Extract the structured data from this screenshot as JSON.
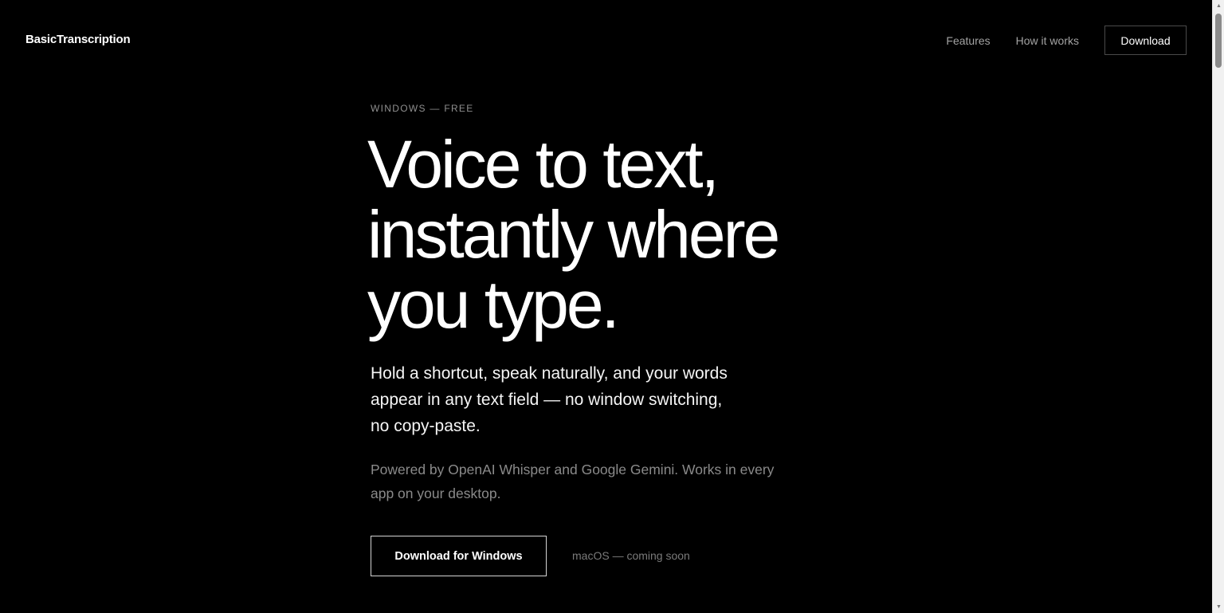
{
  "header": {
    "logo": "BasicTranscription",
    "nav": {
      "features": "Features",
      "how_it_works": "How it works",
      "download": "Download"
    }
  },
  "hero": {
    "eyebrow": "WINDOWS — FREE",
    "headline_lines": [
      "Voice to text,",
      "instantly where",
      "you type."
    ],
    "subhead": "Hold a shortcut, speak naturally, and your words appear in any text field — no window switching, no copy-paste.",
    "note": "Powered by OpenAI Whisper and Google Gemini. Works in every app on your desktop.",
    "cta_label": "Download for Windows",
    "secondary_note": "macOS — coming soon"
  },
  "icons": {
    "scroll_up": "triangle-up-icon",
    "scroll_down": "triangle-down-icon"
  },
  "colors": {
    "background": "#000000",
    "text": "#ffffff",
    "muted": "#8a8a8a",
    "border": "#4a4a4a"
  }
}
